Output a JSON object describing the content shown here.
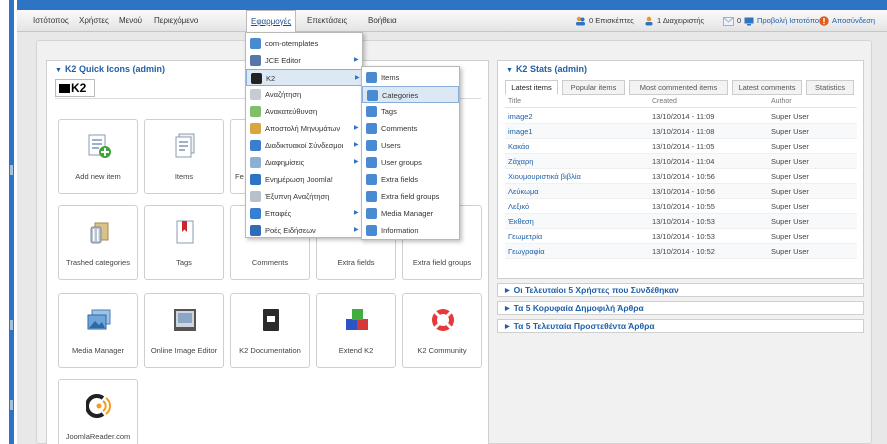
{
  "menubar": {
    "items": [
      "Ιστότοπος",
      "Χρήστες",
      "Μενού",
      "Περιεχόμενο",
      "Εφαρμογές",
      "Επεκτάσεις",
      "Βοήθεια"
    ],
    "active_index": 4
  },
  "status": {
    "visitors": "0 Επισκέπτες",
    "admins": "1 Διαχειριστής",
    "messages": "0",
    "view_site": "Προβολή Ιστοτόπου",
    "logout": "Αποσύνδεση"
  },
  "quick_icons": {
    "title": "K2 Quick Icons (admin)",
    "logo": "K2",
    "items": [
      {
        "label": "Add new item",
        "icon": "add-item-icon"
      },
      {
        "label": "Items",
        "icon": "items-icon"
      },
      {
        "label": "Fe",
        "icon": "featured-icon"
      },
      {
        "label": "Trashed categories",
        "icon": "trash-icon"
      },
      {
        "label": "Tags",
        "icon": "tags-icon"
      },
      {
        "label": "Comments",
        "icon": "comments-icon"
      },
      {
        "label": "Extra fields",
        "icon": "extra-fields-icon"
      },
      {
        "label": "Extra field groups",
        "icon": "extra-field-groups-icon"
      },
      {
        "label": "Media Manager",
        "icon": "media-manager-icon"
      },
      {
        "label": "Online Image Editor",
        "icon": "image-editor-icon"
      },
      {
        "label": "K2 Documentation",
        "icon": "documentation-icon"
      },
      {
        "label": "Extend K2",
        "icon": "extend-icon"
      },
      {
        "label": "K2 Community",
        "icon": "community-icon"
      },
      {
        "label": "JoomlaReader.com",
        "icon": "joomlareader-icon"
      }
    ]
  },
  "stats": {
    "title": "K2 Stats (admin)",
    "tabs": [
      "Latest items",
      "Popular items",
      "Most commented items",
      "Latest comments",
      "Statistics"
    ],
    "active_tab": 0,
    "columns": [
      "Title",
      "Created",
      "Author"
    ],
    "rows": [
      {
        "title": "image2",
        "created": "13/10/2014 - 11:09",
        "author": "Super User"
      },
      {
        "title": "image1",
        "created": "13/10/2014 - 11:08",
        "author": "Super User"
      },
      {
        "title": "Κακάο",
        "created": "13/10/2014 - 11:05",
        "author": "Super User"
      },
      {
        "title": "Ζάχαρη",
        "created": "13/10/2014 - 11:04",
        "author": "Super User"
      },
      {
        "title": "Χιουμουριστικά βιβλία",
        "created": "13/10/2014 - 10:56",
        "author": "Super User"
      },
      {
        "title": "Λεύκωμα",
        "created": "13/10/2014 - 10:56",
        "author": "Super User"
      },
      {
        "title": "Λεξικό",
        "created": "13/10/2014 - 10:55",
        "author": "Super User"
      },
      {
        "title": "Έκθεση",
        "created": "13/10/2014 - 10:53",
        "author": "Super User"
      },
      {
        "title": "Γεωμετρία",
        "created": "13/10/2014 - 10:53",
        "author": "Super User"
      },
      {
        "title": "Γεωγραφία",
        "created": "13/10/2014 - 10:52",
        "author": "Super User"
      }
    ]
  },
  "collapsed_panels": [
    "Οι Τελευταίοι 5 Χρήστες που Συνδέθηκαν",
    "Τα 5 Κορυφαία Δημοφιλή Άρθρα",
    "Τα 5 Τελευταία Προστεθέντα Άρθρα"
  ],
  "apps_menu": {
    "items": [
      {
        "label": "com-otemplates",
        "submenu": false
      },
      {
        "label": "JCE Editor",
        "submenu": true
      },
      {
        "label": "K2",
        "submenu": true
      },
      {
        "label": "Αναζήτηση",
        "submenu": false
      },
      {
        "label": "Ανακατεύθυνση",
        "submenu": false
      },
      {
        "label": "Αποστολή Μηνυμάτων",
        "submenu": true
      },
      {
        "label": "Διαδικτυακοί Σύνδεσμοι",
        "submenu": true
      },
      {
        "label": "Διαφημίσεις",
        "submenu": true
      },
      {
        "label": "Ενημέρωση Joomla!",
        "submenu": false
      },
      {
        "label": "Έξυπνη Αναζήτηση",
        "submenu": false
      },
      {
        "label": "Επαφές",
        "submenu": true
      },
      {
        "label": "Ροές Ειδήσεων",
        "submenu": true
      }
    ],
    "highlighted_index": 2
  },
  "k2_submenu": {
    "items": [
      "Items",
      "Categories",
      "Tags",
      "Comments",
      "Users",
      "User groups",
      "Extra fields",
      "Extra field groups",
      "Media Manager",
      "Information"
    ],
    "highlighted_index": 1
  },
  "colors": {
    "accent": "#2d74c4",
    "link": "#1f5fa8",
    "logout": "#e05a1c"
  }
}
